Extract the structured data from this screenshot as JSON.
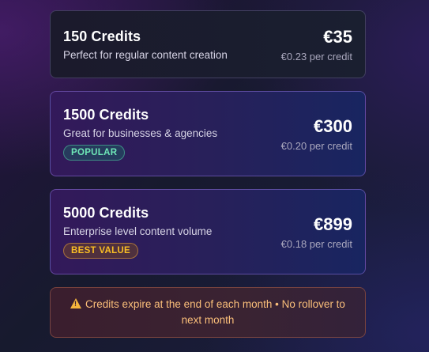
{
  "packages": [
    {
      "title": "150 Credits",
      "description": "Perfect for regular content creation",
      "price": "€35",
      "per_credit": "€0.23 per credit",
      "badge": ""
    },
    {
      "title": "1500 Credits",
      "description": "Great for businesses & agencies",
      "price": "€300",
      "per_credit": "€0.20 per credit",
      "badge": "POPULAR"
    },
    {
      "title": "5000 Credits",
      "description": "Enterprise level content volume",
      "price": "€899",
      "per_credit": "€0.18 per credit",
      "badge": "BEST VALUE"
    }
  ],
  "notice": {
    "icon": "warning-icon",
    "text": "Credits expire at the end of each month • No rollover to next month"
  },
  "colors": {
    "popular_badge": "#6ee7b7",
    "best_value_badge": "#fbbf24",
    "notice_text": "#fbbf7a"
  }
}
